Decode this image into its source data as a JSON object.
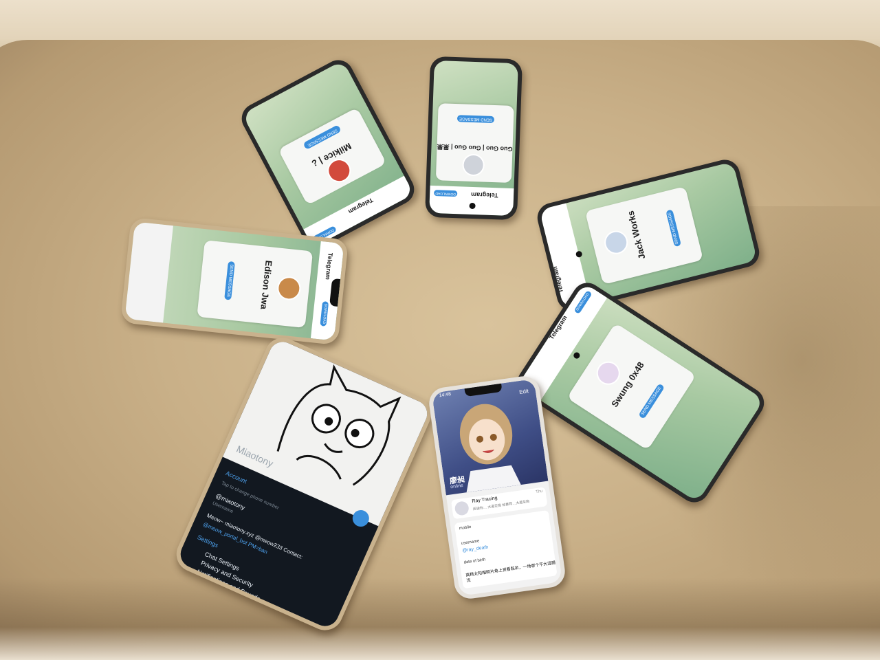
{
  "phones": {
    "p1": {
      "app": "Telegram",
      "name": "Milkice | ¿",
      "button": "SEND MESSAGE",
      "download": "DOWNLOAD"
    },
    "p2": {
      "app": "Telegram",
      "name": "Guo Guo | Guo Guo | 果果",
      "button": "SEND MESSAGE",
      "download": "DOWNLOAD"
    },
    "p3": {
      "app": "Telegram",
      "name": "Jack Works",
      "button": "SEND MESSAGE"
    },
    "p4": {
      "app": "Telegram",
      "name": "Edison Jwa",
      "button": "SEND MESSAGE",
      "download": "DOWNLOAD"
    },
    "p5": {
      "app": "Telegram",
      "name": "Swung 0x48",
      "button": "SEND MESSAGE",
      "download": "DOWNLOAD"
    },
    "p6": {
      "profile_name": "Miaotony",
      "section_account": "Account",
      "hint": "Tap to change phone number",
      "username": "@miaotony",
      "username_label": "Username",
      "bio_line1": "Meow~ miaotony.xyz @meow233 Contact:",
      "bio_line2": "@meow_portal_bot PM=ban",
      "section_settings": "Settings",
      "item1": "Chat Settings",
      "item2": "Privacy and Security",
      "item3": "Notifications and Sounds"
    },
    "p7": {
      "time": "14:48",
      "edit": "Edit",
      "name": "廖昶",
      "status": "online",
      "channel_name": "Ray Tracing",
      "channel_sub": "阅读你… 大道至简 给推荐…大道至简",
      "channel_day": "Thu",
      "mobile_label": "mobile",
      "username_label": "username",
      "username": "@ray_death",
      "birth_label": "date of birth",
      "bio": "高精太阳帽照片角上贤看既吊，一场哪个不大涯踢流"
    }
  }
}
